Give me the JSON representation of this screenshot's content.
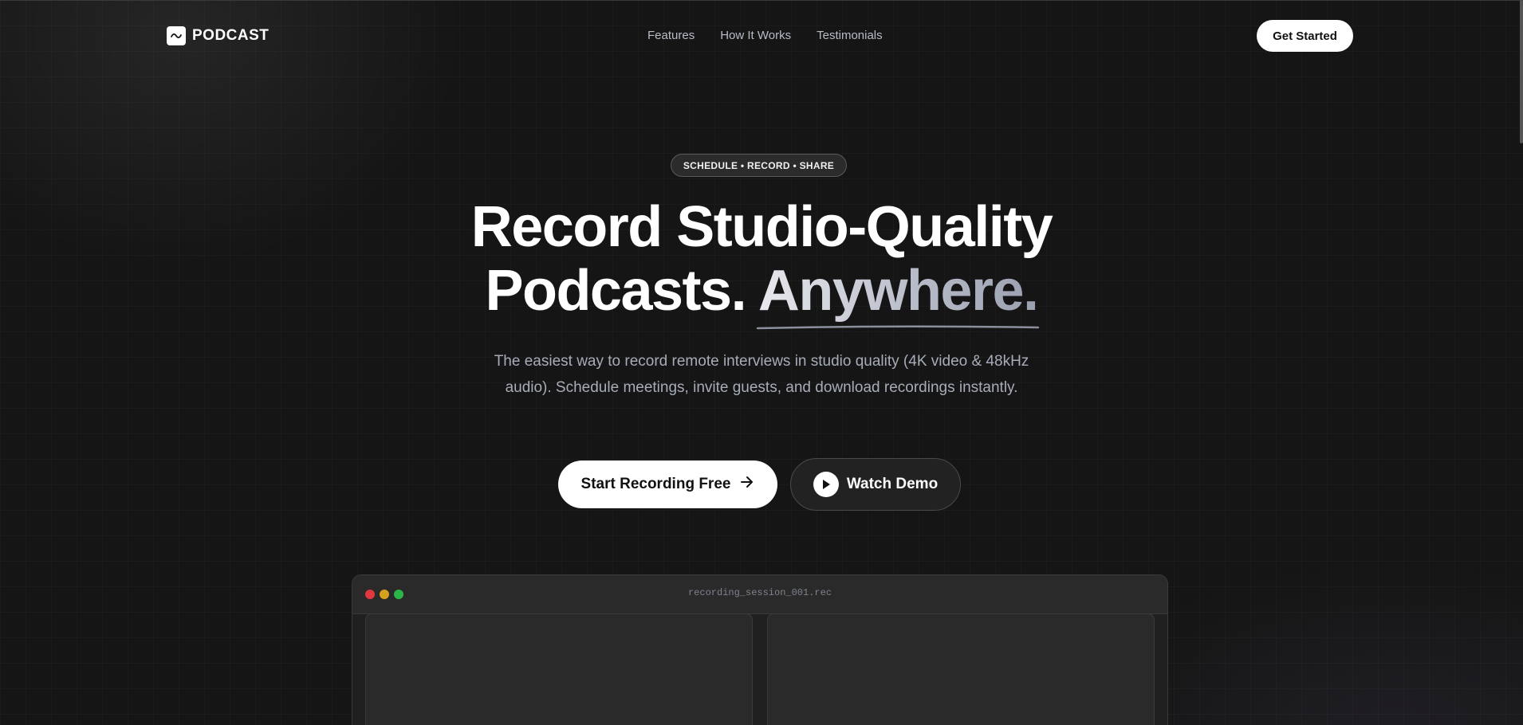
{
  "nav": {
    "brand": "PODCAST",
    "links": [
      {
        "label": "Features"
      },
      {
        "label": "How It Works"
      },
      {
        "label": "Testimonials"
      }
    ],
    "cta_label": "Get Started"
  },
  "hero": {
    "badge": "SCHEDULE • RECORD • SHARE",
    "headline_line1": "Record Studio-Quality",
    "headline_line2_plain": "Podcasts.",
    "headline_line2_accent": "Anywhere.",
    "subtext": "The easiest way to record remote interviews in studio quality (4K video & 48kHz audio). Schedule meetings, invite guests, and download recordings instantly.",
    "primary_cta": "Start Recording Free",
    "secondary_cta": "Watch Demo"
  },
  "preview": {
    "window_title": "recording_session_001.rec"
  },
  "colors": {
    "background": "#151515",
    "accent_white": "#ffffff",
    "muted_text": "#a7acb8",
    "traffic_red": "#e0383e",
    "traffic_yellow": "#d6a21d",
    "traffic_green": "#2bb549"
  },
  "icons": {
    "logo": "waveform-icon",
    "primary_cta": "arrow-right-icon",
    "secondary_cta": "play-icon"
  }
}
